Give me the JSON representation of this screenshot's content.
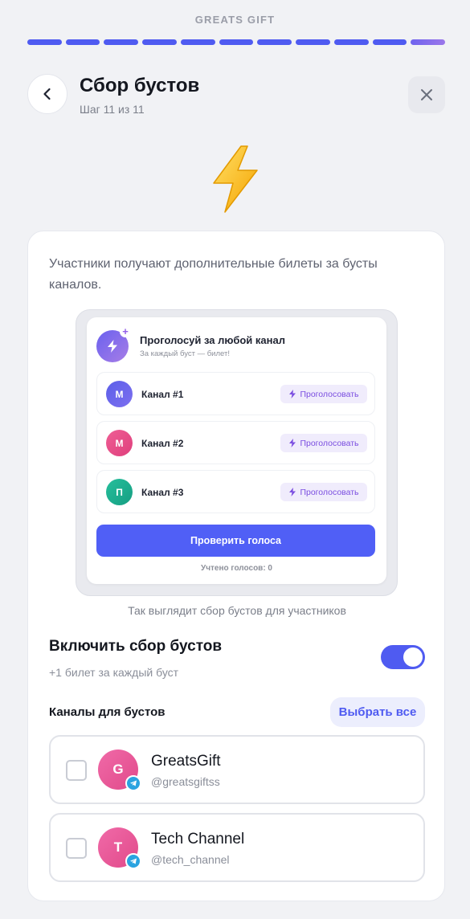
{
  "brand": "GREATS GIFT",
  "progress": {
    "total_steps": 11,
    "current_step": 11
  },
  "header": {
    "title": "Сбор бустов",
    "step_text": "Шаг 11 из 11",
    "back_icon": "chevron-left-icon",
    "close_icon": "close-icon"
  },
  "hero_icon": "lightning-emoji",
  "description": "Участники получают дополнительные билеты за бусты каналов.",
  "preview": {
    "title": "Проголосуй за любой канал",
    "subtitle": "За каждый буст — билет!",
    "channels": [
      {
        "initial": "М",
        "name": "Канал #1",
        "vote_label": "Проголосовать",
        "color": "#5b5fe9"
      },
      {
        "initial": "М",
        "name": "Канал #2",
        "vote_label": "Проголосовать",
        "color": "#e9457f"
      },
      {
        "initial": "П",
        "name": "Канал #3",
        "vote_label": "Проголосовать",
        "color": "#1fae8f"
      }
    ],
    "check_button": "Проверить голоса",
    "counted": "Учтено голосов: 0"
  },
  "preview_caption": "Так выглядит сбор бустов для участников",
  "boost_toggle": {
    "title": "Включить сбор бустов",
    "subtitle": "+1 билет за каждый буст",
    "enabled": true
  },
  "channels_section": {
    "label": "Каналы для бустов",
    "select_all": "Выбрать все",
    "items": [
      {
        "initial": "G",
        "name": "GreatsGift",
        "handle": "@greatsgiftss",
        "checked": false
      },
      {
        "initial": "T",
        "name": "Tech Channel",
        "handle": "@tech_channel",
        "checked": false
      }
    ]
  },
  "colors": {
    "accent": "#4f5bf1",
    "background": "#f1f2f5",
    "vote_text": "#7a4de0",
    "telegram": "#2aa3e0"
  }
}
